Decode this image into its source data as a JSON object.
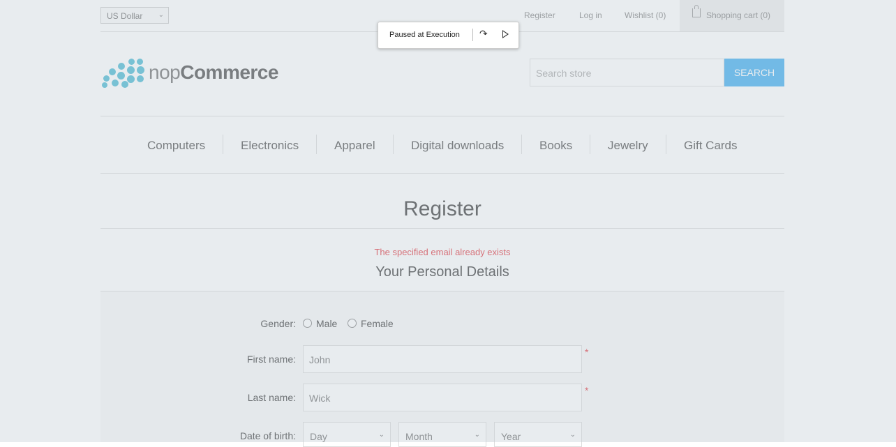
{
  "header": {
    "currency": "US Dollar",
    "links": {
      "register": "Register",
      "login": "Log in",
      "wishlist": "Wishlist (0)",
      "cart": "Shopping cart (0)"
    }
  },
  "debugger": {
    "label": "Paused at Execution",
    "step_icon": "↷"
  },
  "logo": {
    "part1": "nop",
    "part2": "Commerce"
  },
  "search": {
    "placeholder": "Search store",
    "button": "SEARCH"
  },
  "menu": [
    "Computers",
    "Electronics",
    "Apparel",
    "Digital downloads",
    "Books",
    "Jewelry",
    "Gift Cards"
  ],
  "page": {
    "title": "Register",
    "error": "The specified email already exists",
    "section": "Your Personal Details"
  },
  "form": {
    "gender_label": "Gender:",
    "male": "Male",
    "female": "Female",
    "first_name_label": "First name:",
    "first_name_value": "John",
    "last_name_label": "Last name:",
    "last_name_value": "Wick",
    "dob_label": "Date of birth:",
    "day": "Day",
    "month": "Month",
    "year": "Year",
    "required": "*"
  },
  "colors": {
    "accent": "#4ab2f1",
    "error": "#e4434b",
    "logo_dots": "#53bdd6"
  }
}
